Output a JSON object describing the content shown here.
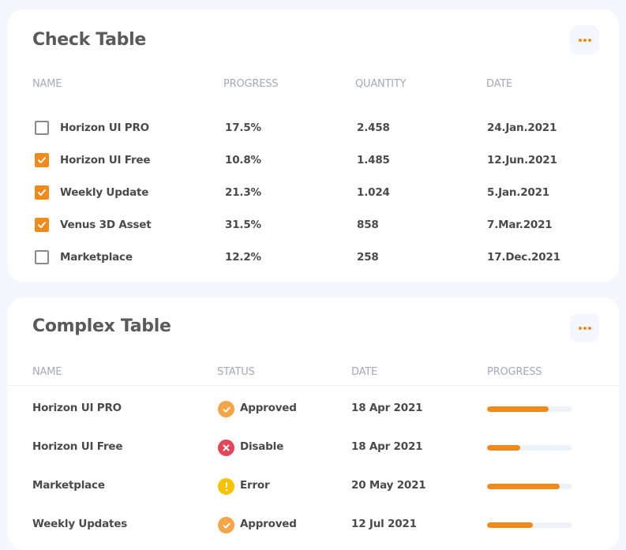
{
  "check_table": {
    "title": "Check Table",
    "headers": [
      "NAME",
      "PROGRESS",
      "QUANTITY",
      "DATE"
    ],
    "rows": [
      {
        "name": "Horizon UI PRO",
        "progress": "17.5%",
        "quantity": "2.458",
        "date": "24.Jan.2021",
        "checked": false
      },
      {
        "name": "Horizon UI Free",
        "progress": "10.8%",
        "quantity": "1.485",
        "date": "12.Jun.2021",
        "checked": true
      },
      {
        "name": "Weekly Update",
        "progress": "21.3%",
        "quantity": "1.024",
        "date": "5.Jan.2021",
        "checked": true
      },
      {
        "name": "Venus 3D Asset",
        "progress": "31.5%",
        "quantity": "858",
        "date": "7.Mar.2021",
        "checked": true
      },
      {
        "name": "Marketplace",
        "progress": "12.2%",
        "quantity": "258",
        "date": "17.Dec.2021",
        "checked": false
      }
    ]
  },
  "complex_table": {
    "title": "Complex Table",
    "headers": [
      "NAME",
      "STATUS",
      "DATE",
      "PROGRESS"
    ],
    "rows": [
      {
        "name": "Horizon UI PRO",
        "status": "Approved",
        "status_icon": "check-circle-icon",
        "date": "18 Apr 2021",
        "progress": 0.72
      },
      {
        "name": "Horizon UI Free",
        "status": "Disable",
        "status_icon": "x-circle-icon",
        "date": "18 Apr 2021",
        "progress": 0.39
      },
      {
        "name": "Marketplace",
        "status": "Error",
        "status_icon": "alert-circle-icon",
        "date": "20 May 2021",
        "progress": 0.85
      },
      {
        "name": "Weekly Updates",
        "status": "Approved",
        "status_icon": "check-circle-icon",
        "date": "12 Jul 2021",
        "progress": 0.54
      }
    ]
  },
  "colors": {
    "accent": "#f08a1d",
    "approved": "#f5a447",
    "disable": "#e1465b",
    "error": "#f7c200"
  }
}
